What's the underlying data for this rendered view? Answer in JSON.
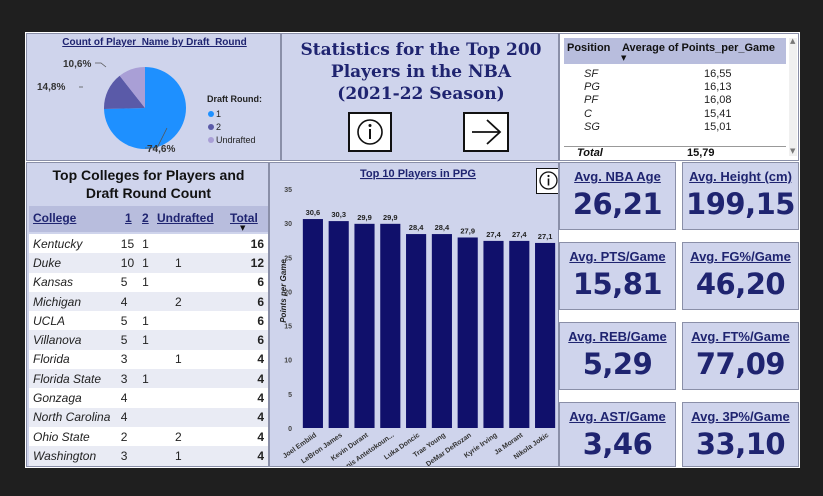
{
  "dashboard_title": [
    "Statistics for the Top 200",
    "Players in the NBA",
    "(2021-22 Season)"
  ],
  "colors": {
    "navy": "#10106b",
    "panel": "#cfd4ec",
    "pie_1": "#1e90ff",
    "pie_2": "#5a5aa8",
    "pie_undrafted": "#a99fd6"
  },
  "buttons": {
    "info_icon": "info-icon",
    "next_icon": "arrow-right-icon"
  },
  "pie": {
    "title": "Count of Player_Name by Draft_Round",
    "legend_title": "Draft Round:",
    "legend": [
      "1",
      "2",
      "Undrafted"
    ],
    "labels": [
      "74,6%",
      "14,8%",
      "10,6%"
    ]
  },
  "colleges": {
    "title_line1": "Top Colleges for Players and",
    "title_line2": "Draft Round Count",
    "headers": [
      "College",
      "1",
      "2",
      "Undrafted",
      "Total"
    ],
    "rows": [
      {
        "college": "Kentucky",
        "r1": "15",
        "r2": "1",
        "und": "",
        "total": "16"
      },
      {
        "college": "Duke",
        "r1": "10",
        "r2": "1",
        "und": "1",
        "total": "12"
      },
      {
        "college": "Kansas",
        "r1": "5",
        "r2": "1",
        "und": "",
        "total": "6"
      },
      {
        "college": "Michigan",
        "r1": "4",
        "r2": "",
        "und": "2",
        "total": "6"
      },
      {
        "college": "UCLA",
        "r1": "5",
        "r2": "1",
        "und": "",
        "total": "6"
      },
      {
        "college": "Villanova",
        "r1": "5",
        "r2": "1",
        "und": "",
        "total": "6"
      },
      {
        "college": "Florida",
        "r1": "3",
        "r2": "",
        "und": "1",
        "total": "4"
      },
      {
        "college": "Florida State",
        "r1": "3",
        "r2": "1",
        "und": "",
        "total": "4"
      },
      {
        "college": "Gonzaga",
        "r1": "4",
        "r2": "",
        "und": "",
        "total": "4"
      },
      {
        "college": "North Carolina",
        "r1": "4",
        "r2": "",
        "und": "",
        "total": "4"
      },
      {
        "college": "Ohio State",
        "r1": "2",
        "r2": "",
        "und": "2",
        "total": "4"
      },
      {
        "college": "Washington",
        "r1": "3",
        "r2": "",
        "und": "1",
        "total": "4"
      }
    ]
  },
  "positions": {
    "headers": [
      "Position",
      "Average of Points_per_Game"
    ],
    "rows": [
      {
        "pos": "SF",
        "val": "16,55"
      },
      {
        "pos": "PG",
        "val": "16,13"
      },
      {
        "pos": "PF",
        "val": "16,08"
      },
      {
        "pos": "C",
        "val": "15,41"
      },
      {
        "pos": "SG",
        "val": "15,01"
      }
    ],
    "total_label": "Total",
    "total_value": "15,79"
  },
  "kpis": [
    {
      "label": "Avg. NBA Age",
      "value": "26,21"
    },
    {
      "label": "Avg. Height (cm)",
      "value": "199,15"
    },
    {
      "label": "Avg. PTS/Game",
      "value": "15,81"
    },
    {
      "label": "Avg. FG%/Game",
      "value": "46,20"
    },
    {
      "label": "Avg. REB/Game",
      "value": "5,29"
    },
    {
      "label": "Avg. FT%/Game",
      "value": "77,09"
    },
    {
      "label": "Avg. AST/Game",
      "value": "3,46"
    },
    {
      "label": "Avg. 3P%/Game",
      "value": "33,10"
    }
  ],
  "chart_data": [
    {
      "type": "pie",
      "title": "Count of Player_Name by Draft_Round",
      "categories": [
        "1",
        "2",
        "Undrafted"
      ],
      "values": [
        74.6,
        14.8,
        10.6
      ],
      "value_labels": [
        "74,6%",
        "14,8%",
        "10,6%"
      ],
      "legend": "right"
    },
    {
      "type": "bar",
      "title": "Top 10 Players in PPG",
      "ylabel": "Points per Game",
      "xlabel": "",
      "categories": [
        "Joel Embiid",
        "LeBron James",
        "Kevin Durant",
        "Giannis Antetokoun...",
        "Luka Doncic",
        "Trae Young",
        "DeMar DeRozan",
        "Kyrie Irving",
        "Ja Morant",
        "Nikola Jokic"
      ],
      "values": [
        30.6,
        30.3,
        29.9,
        29.9,
        28.4,
        28.4,
        27.9,
        27.4,
        27.4,
        27.1
      ],
      "value_labels": [
        "30,6",
        "30,3",
        "29,9",
        "29,9",
        "28,4",
        "28,4",
        "27,9",
        "27,4",
        "27,4",
        "27,1"
      ],
      "yticks": [
        "0",
        "5",
        "10",
        "15",
        "20",
        "25",
        "30",
        "35"
      ],
      "ylim": [
        0,
        35
      ],
      "grid": false
    }
  ]
}
